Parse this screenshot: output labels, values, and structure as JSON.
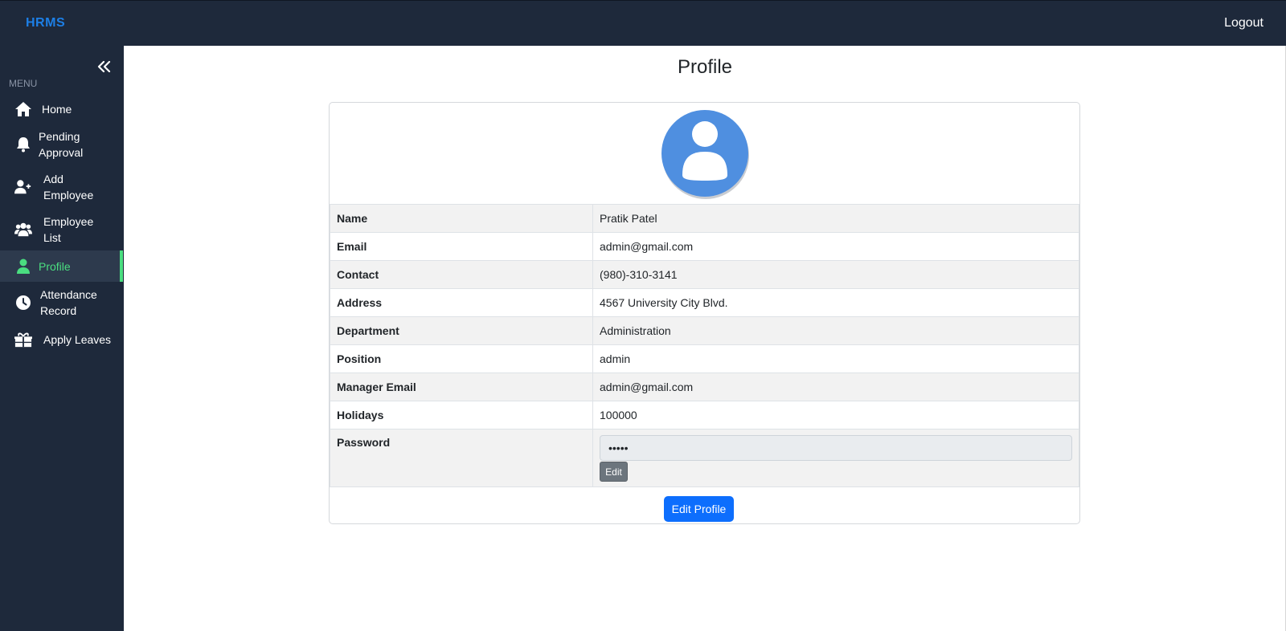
{
  "app": {
    "brand": "HRMS",
    "logout_label": "Logout"
  },
  "sidebar": {
    "menu_label": "MENU",
    "items": [
      {
        "label": "Home",
        "icon": "home-icon"
      },
      {
        "label": "Pending Approval",
        "icon": "bell-icon"
      },
      {
        "label": "Add Employee",
        "icon": "user-plus-icon"
      },
      {
        "label": "Employee List",
        "icon": "users-icon"
      },
      {
        "label": "Profile",
        "icon": "user-icon",
        "active": true
      },
      {
        "label": "Attendance Record",
        "icon": "clock-icon"
      },
      {
        "label": "Apply Leaves",
        "icon": "gift-icon"
      }
    ],
    "active_color": "#4ade80"
  },
  "page": {
    "title": "Profile"
  },
  "profile": {
    "rows": [
      {
        "key": "Name",
        "value": "Pratik Patel"
      },
      {
        "key": "Email",
        "value": "admin@gmail.com"
      },
      {
        "key": "Contact",
        "value": "(980)-310-3141"
      },
      {
        "key": "Address",
        "value": "4567 University City Blvd."
      },
      {
        "key": "Department",
        "value": "Administration"
      },
      {
        "key": "Position",
        "value": "admin"
      },
      {
        "key": "Manager Email",
        "value": "admin@gmail.com"
      },
      {
        "key": "Holidays",
        "value": "100000"
      }
    ],
    "password": {
      "key": "Password",
      "value": "•••••",
      "edit_label": "Edit"
    },
    "edit_profile_label": "Edit Profile"
  },
  "colors": {
    "topbar": "#1e293b",
    "brand": "#1d7fe6",
    "primary_button": "#0d6efd",
    "avatar": "#4f8fe0"
  }
}
